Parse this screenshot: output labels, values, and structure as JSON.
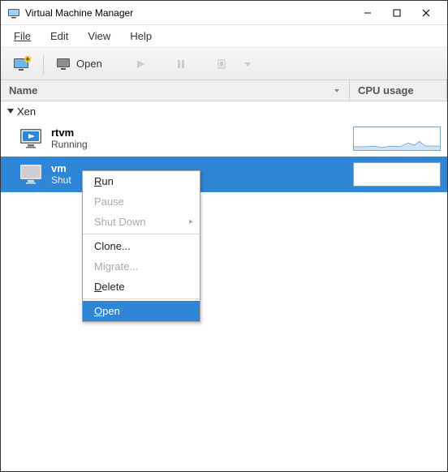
{
  "window": {
    "title": "Virtual Machine Manager"
  },
  "menubar": {
    "file": "File",
    "edit": "Edit",
    "view": "View",
    "help": "Help"
  },
  "toolbar": {
    "open": "Open"
  },
  "columns": {
    "name": "Name",
    "cpu": "CPU usage"
  },
  "host": {
    "name": "Xen"
  },
  "vms": [
    {
      "name": "rtvm",
      "status": "Running"
    },
    {
      "name": "vm",
      "status": "Shutoff"
    }
  ],
  "context_menu": {
    "run": "Run",
    "pause": "Pause",
    "shutdown": "Shut Down",
    "clone": "Clone...",
    "migrate": "Migrate...",
    "delete": "Delete",
    "open": "Open"
  }
}
